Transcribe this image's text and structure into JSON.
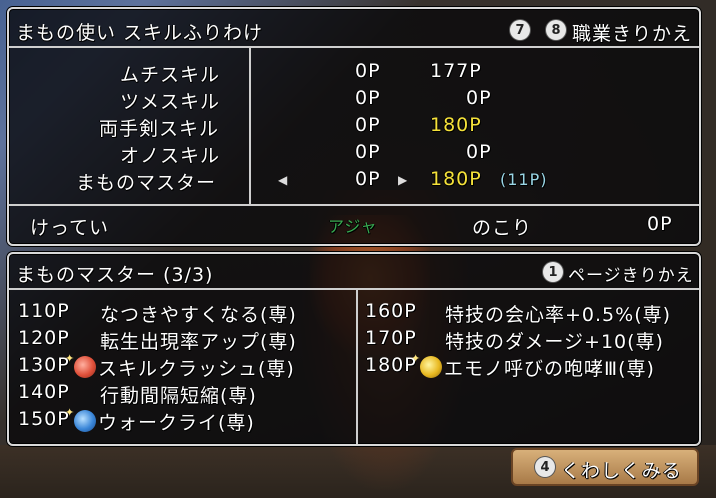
{
  "header": {
    "title": "まもの使い スキルふりわけ",
    "badge7": "7",
    "badge8": "8",
    "job_change": "職業きりかえ"
  },
  "skills": [
    {
      "name": "ムチスキル",
      "points": "0P",
      "total": "177P"
    },
    {
      "name": "ツメスキル",
      "points": "0P",
      "total": "0P"
    },
    {
      "name": "両手剣スキル",
      "points": "0P",
      "total": "180P"
    },
    {
      "name": "オノスキル",
      "points": "0P",
      "total": "0P"
    },
    {
      "name": "まものマスター",
      "points": "0P",
      "total": "180P",
      "extra": "(11P)"
    }
  ],
  "confirm": {
    "label": "けってい",
    "center": "アジャ",
    "remaining_label": "のこり",
    "remaining_value": "0P"
  },
  "master_panel": {
    "title": "まものマスター (3/3)",
    "page_badge": "1",
    "page_switch": "ページきりかえ",
    "left_entries": [
      {
        "pts": "110P",
        "name": "なつきやすくなる(専)"
      },
      {
        "pts": "120P",
        "name": "転生出現率アップ(専)"
      },
      {
        "pts": "130P",
        "name": "スキルクラッシュ(専)",
        "icon": "skill-crash-icon"
      },
      {
        "pts": "140P",
        "name": "行動間隔短縮(専)"
      },
      {
        "pts": "150P",
        "name": "ウォークライ(専)",
        "icon": "war-cry-icon"
      }
    ],
    "right_entries": [
      {
        "pts": "160P",
        "name": "特技の会心率+0.5%(専)"
      },
      {
        "pts": "170P",
        "name": "特技のダメージ+10(専)"
      },
      {
        "pts": "180P",
        "name": "エモノ呼びの咆哮Ⅲ(専)",
        "icon": "emono-roar-icon"
      }
    ]
  },
  "detail_button": {
    "badge": "4",
    "label": "くわしくみる"
  },
  "colors": {
    "highlight": "#f5e23a",
    "extra": "#9ad6e6",
    "center": "#38a850"
  }
}
